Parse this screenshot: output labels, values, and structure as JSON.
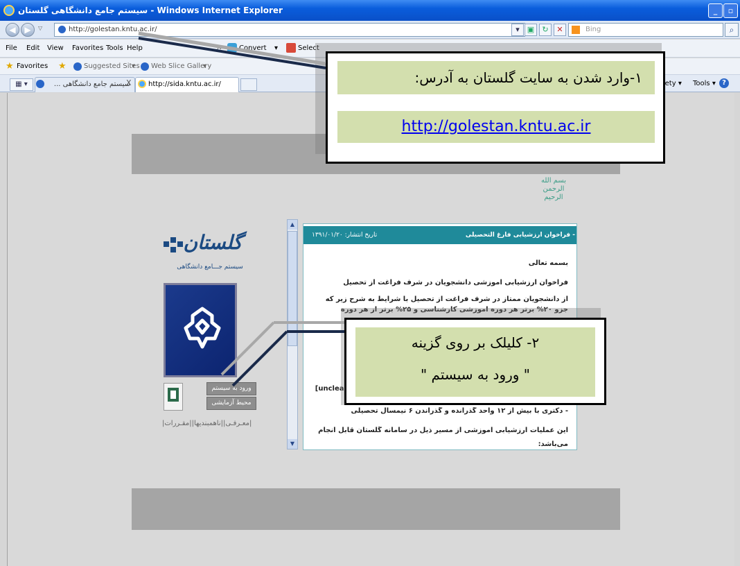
{
  "window": {
    "title": "سیستم جامع دانشگاهی گلستان - Windows Internet Explorer"
  },
  "address_bar": {
    "url": "http://golestan.kntu.ac.ir/",
    "search_placeholder": "Bing"
  },
  "menu": {
    "items": [
      "File",
      "Edit",
      "View",
      "Favorites",
      "Tools",
      "Help"
    ],
    "convert_label": "Convert",
    "select_label": "Select"
  },
  "favorites_bar": {
    "favorites_label": "Favorites",
    "suggested_sites": "Suggested Sites",
    "web_slice_gallery": "Web Slice Gallery",
    "safety": "afety",
    "tools": "Tools"
  },
  "tabs": [
    {
      "label": "سیستم جامع دانشگاهی ..."
    },
    {
      "label": "http://sida.kntu.ac.ir/"
    }
  ],
  "page": {
    "basmala": "بسم الله الرحمن الرحیم",
    "logo_word": "گلستان",
    "logo_subtitle": "سیستم جـــامع دانشگاهی",
    "login_button": "ورود به سیستم",
    "test_env_button": "محیط آزمایشی",
    "bottom_links": "|معـرفـی||ناهمبندیها||مقـررات|"
  },
  "announcement": {
    "title": "- فراخوان ارزشیابی فارغ التحصیلی",
    "date": "تاریخ انتشار: ۱۳۹۱/۰۱/۲۰",
    "lines": [
      "بسمه تعالی",
      "فراخوان ارزشیابی آموزشی دانشجویان در شرف فراغت از تحصیل",
      "از  دانشجویان ممتاز  در شرف فراغت از تحصیل با شرایط به شرح زیر که",
      "جزو ۲۰%  برتر هر دوره آموزشی کارشناسی و ۲۵% برتر از هر دوره",
      "- دکتری با بیش از ۱۲ واحد گذرانده و گذراندن ۶ نیمسال تحصیلی",
      "این عملیات ارزشیابی آموزشی از مسیر ذیل در سامانه گلستان قابل انجام",
      "می‌باشد:"
    ],
    "partial_line": "[unclear]"
  },
  "callouts": {
    "step1_text": "۱-وارد شدن به سایت گلستان به آدرس:",
    "step1_url": "http://golestan.kntu.ac.ir",
    "step2_line1": "۲- کلیلک بر روی گزینه",
    "step2_line2": "\" ورود به سیستم \""
  }
}
